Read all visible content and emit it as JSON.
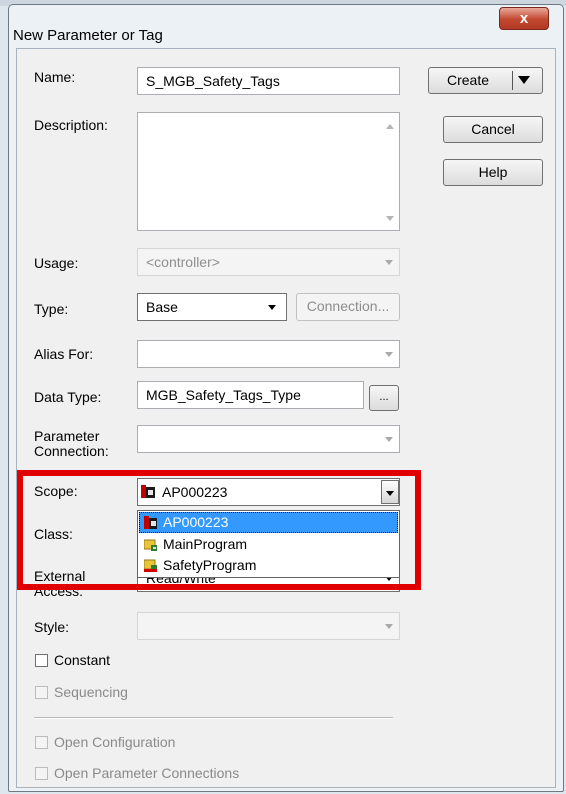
{
  "window": {
    "title": "New Parameter or Tag",
    "close_glyph": "x"
  },
  "form": {
    "name": {
      "label": "Name:",
      "value": "S_MGB_Safety_Tags"
    },
    "description": {
      "label": "Description:",
      "value": ""
    },
    "usage": {
      "label": "Usage:",
      "value": "<controller>"
    },
    "type": {
      "label": "Type:",
      "value": "Base",
      "connection_button": "Connection..."
    },
    "alias_for": {
      "label": "Alias For:",
      "value": ""
    },
    "data_type": {
      "label": "Data Type:",
      "value": "MGB_Safety_Tags_Type",
      "browse_button": "..."
    },
    "parameter_connection": {
      "label_line1": "Parameter",
      "label_line2": "Connection:",
      "value": ""
    },
    "scope": {
      "label": "Scope:",
      "value": "AP000223",
      "options": [
        {
          "label": "AP000223",
          "icon": "controller-icon",
          "selected": true
        },
        {
          "label": "MainProgram",
          "icon": "program-icon",
          "selected": false
        },
        {
          "label": "SafetyProgram",
          "icon": "safety-program-icon",
          "selected": false
        }
      ]
    },
    "class": {
      "label": "Class:"
    },
    "external_access": {
      "label_line1": "External",
      "label_line2": "Access:",
      "value": "Read/Write"
    },
    "style": {
      "label": "Style:",
      "value": ""
    },
    "constant": {
      "label": "Constant",
      "checked": false
    },
    "sequencing": {
      "label": "Sequencing",
      "checked": false
    },
    "open_configuration": {
      "label": "Open Configuration",
      "checked": false
    },
    "open_parameter_connections": {
      "label": "Open Parameter Connections",
      "checked": false
    }
  },
  "buttons": {
    "create": "Create",
    "cancel": "Cancel",
    "help": "Help"
  },
  "colors": {
    "highlight": "#3399ff",
    "annotation": "#e00000",
    "close": "#c2472f"
  }
}
